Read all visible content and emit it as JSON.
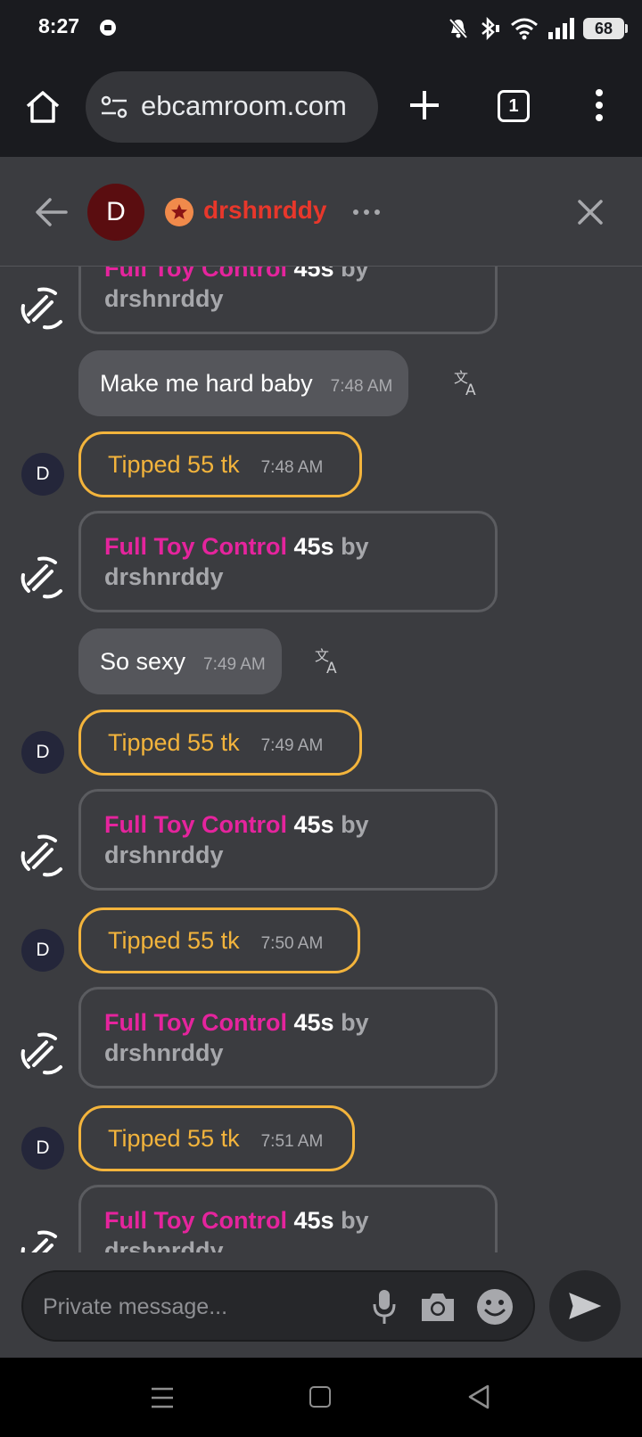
{
  "status_bar": {
    "time": "8:27",
    "battery": "68"
  },
  "browser": {
    "url": "ebcamroom.com",
    "tab_count": "1"
  },
  "chat_header": {
    "avatar_letter": "D",
    "username": "drshnrddy"
  },
  "messages": [
    {
      "type": "toy",
      "title": "Full Toy Control",
      "duration": "45s",
      "by": "by",
      "user": "drshnrddy"
    },
    {
      "type": "msg",
      "text": "Make me hard baby",
      "time": "7:48 AM"
    },
    {
      "type": "tip",
      "avatar": "D",
      "text": "Tipped 55 tk",
      "time": "7:48 AM"
    },
    {
      "type": "toy",
      "title": "Full Toy Control",
      "duration": "45s",
      "by": "by",
      "user": "drshnrddy"
    },
    {
      "type": "msg",
      "text": "So sexy",
      "time": "7:49 AM"
    },
    {
      "type": "tip",
      "avatar": "D",
      "text": "Tipped 55 tk",
      "time": "7:49 AM"
    },
    {
      "type": "toy",
      "title": "Full Toy Control",
      "duration": "45s",
      "by": "by",
      "user": "drshnrddy"
    },
    {
      "type": "tip",
      "avatar": "D",
      "text": "Tipped 55 tk",
      "time": "7:50 AM"
    },
    {
      "type": "toy",
      "title": "Full Toy Control",
      "duration": "45s",
      "by": "by",
      "user": "drshnrddy"
    },
    {
      "type": "tip",
      "avatar": "D",
      "text": "Tipped 55 tk",
      "time": "7:51 AM"
    },
    {
      "type": "toy",
      "title": "Full Toy Control",
      "duration": "45s",
      "by": "by",
      "user": "drshnrddy"
    }
  ],
  "input": {
    "placeholder": "Private message..."
  },
  "colors": {
    "toy_title": "#e5249d",
    "tip": "#f3b43c",
    "username": "#e8372b",
    "background": "#3b3c40"
  },
  "icons": [
    "home-icon",
    "site-settings-icon",
    "plus-icon",
    "tabs-icon",
    "more-vert-icon",
    "back-arrow-icon",
    "star-icon",
    "more-horiz-icon",
    "close-icon",
    "toy-vibration-icon",
    "translate-icon",
    "mic-icon",
    "camera-icon",
    "emoji-icon",
    "send-icon"
  ]
}
